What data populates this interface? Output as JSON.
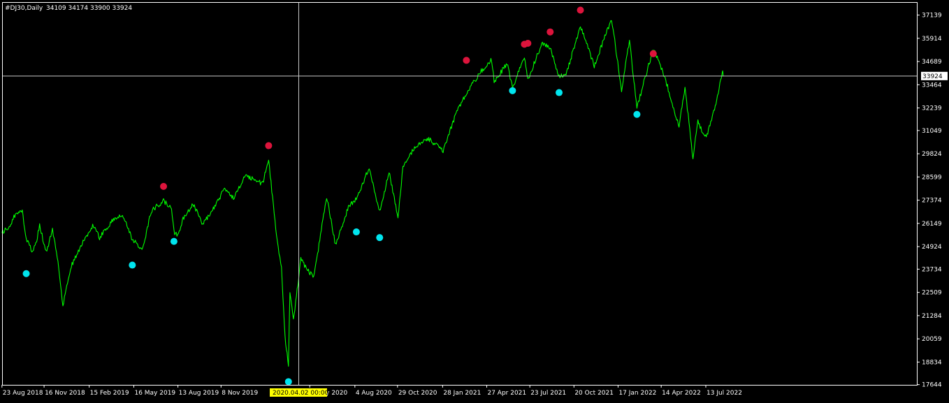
{
  "header": {
    "symbol": "#DJ30,Daily",
    "ohlc": "34109 34174 33900 33924"
  },
  "colors": {
    "background": "#000000",
    "frame": "#ffffff",
    "price_line": "#00ff00",
    "high_marker": "#dc143c",
    "low_marker": "#00e5ee",
    "crosshair": "#c8c8c8",
    "cursor_label_bg": "#ffff00"
  },
  "crosshair": {
    "date": "2020.04.02 00:00",
    "price": "33924"
  },
  "chart_data": {
    "type": "line",
    "title": "#DJ30,Daily",
    "series": [
      {
        "name": "#DJ30,Daily",
        "points": [
          [
            "2018-08-23",
            25650
          ],
          [
            "2018-09-05",
            25950
          ],
          [
            "2018-09-21",
            26700
          ],
          [
            "2018-10-03",
            26830
          ],
          [
            "2018-10-11",
            25300
          ],
          [
            "2018-10-24",
            24600
          ],
          [
            "2018-11-01",
            25200
          ],
          [
            "2018-11-07",
            26100
          ],
          [
            "2018-11-20",
            24600
          ],
          [
            "2018-12-03",
            25800
          ],
          [
            "2018-12-14",
            24100
          ],
          [
            "2018-12-24",
            21800
          ],
          [
            "2019-01-10",
            23900
          ],
          [
            "2019-02-01",
            25100
          ],
          [
            "2019-02-22",
            26050
          ],
          [
            "2019-03-08",
            25400
          ],
          [
            "2019-04-05",
            26400
          ],
          [
            "2019-04-23",
            26650
          ],
          [
            "2019-05-13",
            25300
          ],
          [
            "2019-06-03",
            24800
          ],
          [
            "2019-06-20",
            26800
          ],
          [
            "2019-07-15",
            27350
          ],
          [
            "2019-07-31",
            26900
          ],
          [
            "2019-08-05",
            25700
          ],
          [
            "2019-08-14",
            25500
          ],
          [
            "2019-08-22",
            26300
          ],
          [
            "2019-09-12",
            27200
          ],
          [
            "2019-10-02",
            26100
          ],
          [
            "2019-10-28",
            27100
          ],
          [
            "2019-11-15",
            28000
          ],
          [
            "2019-12-03",
            27500
          ],
          [
            "2019-12-27",
            28650
          ],
          [
            "2020-01-31",
            28250
          ],
          [
            "2020-02-12",
            29550
          ],
          [
            "2020-02-28",
            25400
          ],
          [
            "2020-03-09",
            23850
          ],
          [
            "2020-03-16",
            20190
          ],
          [
            "2020-03-23",
            18591
          ],
          [
            "2020-03-26",
            22550
          ],
          [
            "2020-04-02",
            21000
          ],
          [
            "2020-04-17",
            24240
          ],
          [
            "2020-05-13",
            23250
          ],
          [
            "2020-06-08",
            27572
          ],
          [
            "2020-06-26",
            25000
          ],
          [
            "2020-07-22",
            27000
          ],
          [
            "2020-08-07",
            27450
          ],
          [
            "2020-09-02",
            29100
          ],
          [
            "2020-09-23",
            26760
          ],
          [
            "2020-10-12",
            28840
          ],
          [
            "2020-10-30",
            26500
          ],
          [
            "2020-11-09",
            29160
          ],
          [
            "2020-12-04",
            30200
          ],
          [
            "2020-12-31",
            30600
          ],
          [
            "2021-01-29",
            29980
          ],
          [
            "2021-02-24",
            31960
          ],
          [
            "2021-03-17",
            33000
          ],
          [
            "2021-04-16",
            34200
          ],
          [
            "2021-05-07",
            34770
          ],
          [
            "2021-05-12",
            33590
          ],
          [
            "2021-06-07",
            34600
          ],
          [
            "2021-06-18",
            33290
          ],
          [
            "2021-07-12",
            34990
          ],
          [
            "2021-07-19",
            33740
          ],
          [
            "2021-08-16",
            35620
          ],
          [
            "2021-09-02",
            35440
          ],
          [
            "2021-09-20",
            33900
          ],
          [
            "2021-10-04",
            34000
          ],
          [
            "2021-11-02",
            36565
          ],
          [
            "2021-11-30",
            34480
          ],
          [
            "2022-01-04",
            36950
          ],
          [
            "2022-01-24",
            33150
          ],
          [
            "2022-02-09",
            35770
          ],
          [
            "2022-02-24",
            32270
          ],
          [
            "2022-03-29",
            35370
          ],
          [
            "2022-04-22",
            33800
          ],
          [
            "2022-05-20",
            31250
          ],
          [
            "2022-06-01",
            33300
          ],
          [
            "2022-06-17",
            29650
          ],
          [
            "2022-06-27",
            31500
          ],
          [
            "2022-07-14",
            30630
          ],
          [
            "2022-07-26",
            31760
          ],
          [
            "2022-08-04",
            32700
          ],
          [
            "2022-08-12",
            33750
          ],
          [
            "2022-08-16",
            34109
          ],
          [
            "2022-08-17",
            33924
          ]
        ]
      }
    ],
    "high_markers": [
      [
        "2019-07-15",
        28100
      ],
      [
        "2020-02-12",
        30250
      ],
      [
        "2021-03-17",
        34750
      ],
      [
        "2021-07-12",
        35600
      ],
      [
        "2021-07-19",
        35650
      ],
      [
        "2021-09-02",
        36250
      ],
      [
        "2021-11-02",
        37400
      ],
      [
        "2022-03-29",
        35100
      ]
    ],
    "low_markers": [
      [
        "2018-10-11",
        23500
      ],
      [
        "2019-05-13",
        23950
      ],
      [
        "2019-08-05",
        25200
      ],
      [
        "2020-03-23",
        17800
      ],
      [
        "2020-08-07",
        25700
      ],
      [
        "2020-09-23",
        25400
      ],
      [
        "2021-06-18",
        33150
      ],
      [
        "2021-09-20",
        33050
      ],
      [
        "2022-02-24",
        31900
      ]
    ],
    "x_range": [
      "2018-08-23",
      "2022-10-20"
    ],
    "ylim": [
      17632,
      37787
    ],
    "y_ticks": [
      37139,
      35914,
      34689,
      33464,
      32239,
      31049,
      29824,
      28599,
      27374,
      26149,
      24924,
      23734,
      22509,
      21284,
      20059,
      18834,
      17644
    ],
    "x_tick_labels": [
      [
        "2018-08-23",
        "23 Aug 2018"
      ],
      [
        "2018-11-16",
        "16 Nov 2018"
      ],
      [
        "2019-02-15",
        "15 Feb 2019"
      ],
      [
        "2019-05-16",
        "16 May 2019"
      ],
      [
        "2019-08-13",
        "13 Aug 2019"
      ],
      [
        "2019-11-08",
        "8 Nov 2019"
      ],
      [
        "2020-05-05",
        "5 May 2020"
      ],
      [
        "2020-08-04",
        "4 Aug 2020"
      ],
      [
        "2020-10-29",
        "29 Oct 2020"
      ],
      [
        "2021-01-28",
        "28 Jan 2021"
      ],
      [
        "2021-04-27",
        "27 Apr 2021"
      ],
      [
        "2021-07-23",
        "23 Jul 2021"
      ],
      [
        "2021-10-20",
        "20 Oct 2021"
      ],
      [
        "2022-01-17",
        "17 Jan 2022"
      ],
      [
        "2022-04-14",
        "14 Apr 2022"
      ],
      [
        "2022-07-13",
        "13 Jul 2022"
      ]
    ],
    "grid": false,
    "legend": "none"
  }
}
